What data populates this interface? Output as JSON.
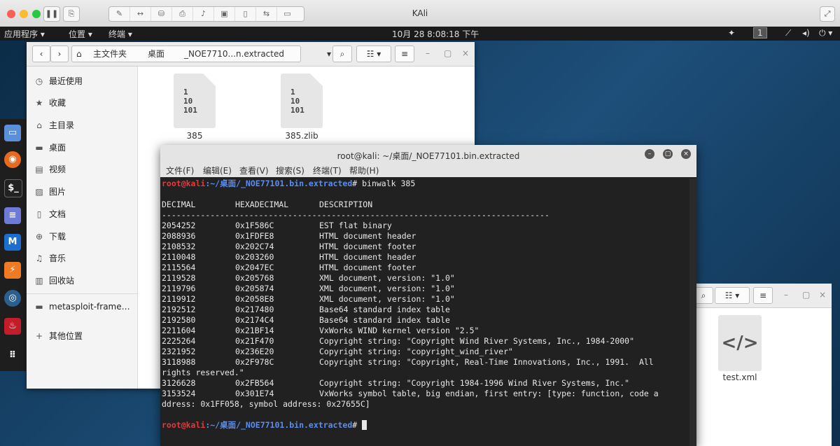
{
  "host": {
    "title": "KAli"
  },
  "panel": {
    "apps": "应用程序 ▾",
    "places": "位置 ▾",
    "terminal": "终端 ▾",
    "clock": "10月 28  8:08:18 下午",
    "workspace": "1"
  },
  "fm": {
    "path": [
      "主文件夹",
      "桌面",
      "_NOE7710...n.extracted"
    ],
    "sidebar": [
      "最近使用",
      "收藏",
      "主目录",
      "桌面",
      "视频",
      "图片",
      "文档",
      "下载",
      "音乐",
      "回收站",
      "metasploit-frame…",
      "其他位置"
    ],
    "files": [
      "385",
      "385.zlib"
    ]
  },
  "fm2": {
    "files": [
      "test.xml"
    ]
  },
  "terminal": {
    "title": "root@kali: ~/桌面/_NOE77101.bin.extracted",
    "menu": [
      "文件(F)",
      "编辑(E)",
      "查看(V)",
      "搜索(S)",
      "终端(T)",
      "帮助(H)"
    ],
    "prompt_user": "root@kali",
    "prompt_path": ":~/桌面/_NOE77101.bin.extracted",
    "command": "# binwalk 385",
    "headers": [
      "DECIMAL",
      "HEXADECIMAL",
      "DESCRIPTION"
    ],
    "separator": "--------------------------------------------------------------------------------",
    "rows": [
      [
        "2054252",
        "0x1F586C",
        "EST flat binary"
      ],
      [
        "2088936",
        "0x1FDFE8",
        "HTML document header"
      ],
      [
        "2108532",
        "0x202C74",
        "HTML document footer"
      ],
      [
        "2110048",
        "0x203260",
        "HTML document header"
      ],
      [
        "2115564",
        "0x2047EC",
        "HTML document footer"
      ],
      [
        "2119528",
        "0x205768",
        "XML document, version: \"1.0\""
      ],
      [
        "2119796",
        "0x205874",
        "XML document, version: \"1.0\""
      ],
      [
        "2119912",
        "0x2058E8",
        "XML document, version: \"1.0\""
      ],
      [
        "2192512",
        "0x217480",
        "Base64 standard index table"
      ],
      [
        "2192580",
        "0x2174C4",
        "Base64 standard index table"
      ],
      [
        "2211604",
        "0x21BF14",
        "VxWorks WIND kernel version \"2.5\""
      ],
      [
        "2225264",
        "0x21F470",
        "Copyright string: \"Copyright Wind River Systems, Inc., 1984-2000\""
      ],
      [
        "2321952",
        "0x236E20",
        "Copyright string: \"copyright_wind_river\""
      ],
      [
        "3118988",
        "0x2F978C",
        "Copyright string: \"Copyright, Real-Time Innovations, Inc., 1991.  All"
      ],
      [
        "",
        "",
        "rights reserved.\""
      ],
      [
        "3126628",
        "0x2FB564",
        "Copyright string: \"Copyright 1984-1996 Wind River Systems, Inc.\""
      ],
      [
        "3153524",
        "0x301E74",
        "VxWorks symbol table, big endian, first entry: [type: function, code a"
      ],
      [
        "",
        "",
        "ddress: 0x1FF058, symbol address: 0x27655C]"
      ]
    ],
    "end_command": "# "
  }
}
